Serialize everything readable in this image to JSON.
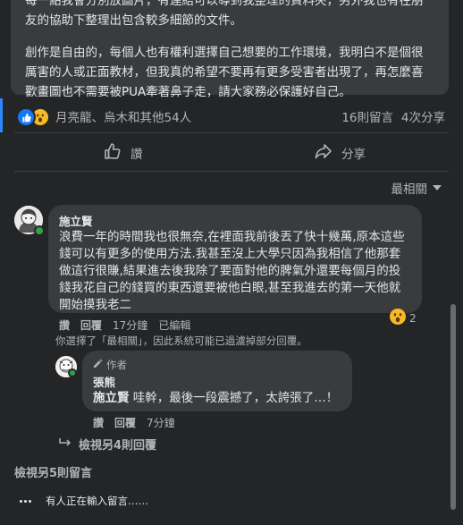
{
  "post": {
    "line1": "每一點我會分別放圖片，有連結可以導到我整理的資料夾，另外我也有在朋友的協助下整理出包含較多細節的文件。",
    "paragraph2": "創作是自由的，每個人也有權利選擇自己想要的工作環境，我明白不是個很厲害的人或正面教材，但我真的希望不要再有更多受害者出現了，再怎麼喜歡畫圖也不需要被PUA牽著鼻子走，請大家務必保護好自己。"
  },
  "stats": {
    "reactors": "月亮龍、烏木和其他54人",
    "comments": "16則留言",
    "shares": "4次分享"
  },
  "actions": {
    "like": "讚",
    "share": "分享"
  },
  "sort": {
    "label": "最相關"
  },
  "comment1": {
    "author": "施立賢",
    "text": "浪費一年的時間我也很無奈,在裡面我前後丟了快十幾萬,原本這些錢可以有更多的使用方法.我甚至沒上大學只因為我相信了他那套做這行很賺,結果進去後我除了要面對他的脾氣外還要每個月的投錢我花自己的錢買的東西還要被他白眼,甚至我進去的第一天他就開始摸我老二",
    "like": "讚",
    "reply": "回覆",
    "time": "17分鐘",
    "edited": "已編輯",
    "reaction_count": "2",
    "reaction_icon": "wow-emoji-icon"
  },
  "filter_note": "你選擇了「最相關」，因此系統可能已過濾掉部分回覆。",
  "reply1": {
    "badge": "作者",
    "author": "張熊",
    "mention": "施立賢",
    "text": " 哇幹，最後一段震撼了，太誇張了…！",
    "like": "讚",
    "reply": "回覆",
    "time": "7分鐘"
  },
  "view_more_replies": "檢視另4則回覆",
  "view_more_comments": "檢視另5則留言",
  "typing": "有人正在輸入留言……",
  "colors": {
    "background": "#242526",
    "bubble": "#3a3b3c",
    "accent": "#2d88ff",
    "like_blue": "#1877f2",
    "wow_yellow": "#f7b928",
    "online_green": "#31a24c"
  }
}
